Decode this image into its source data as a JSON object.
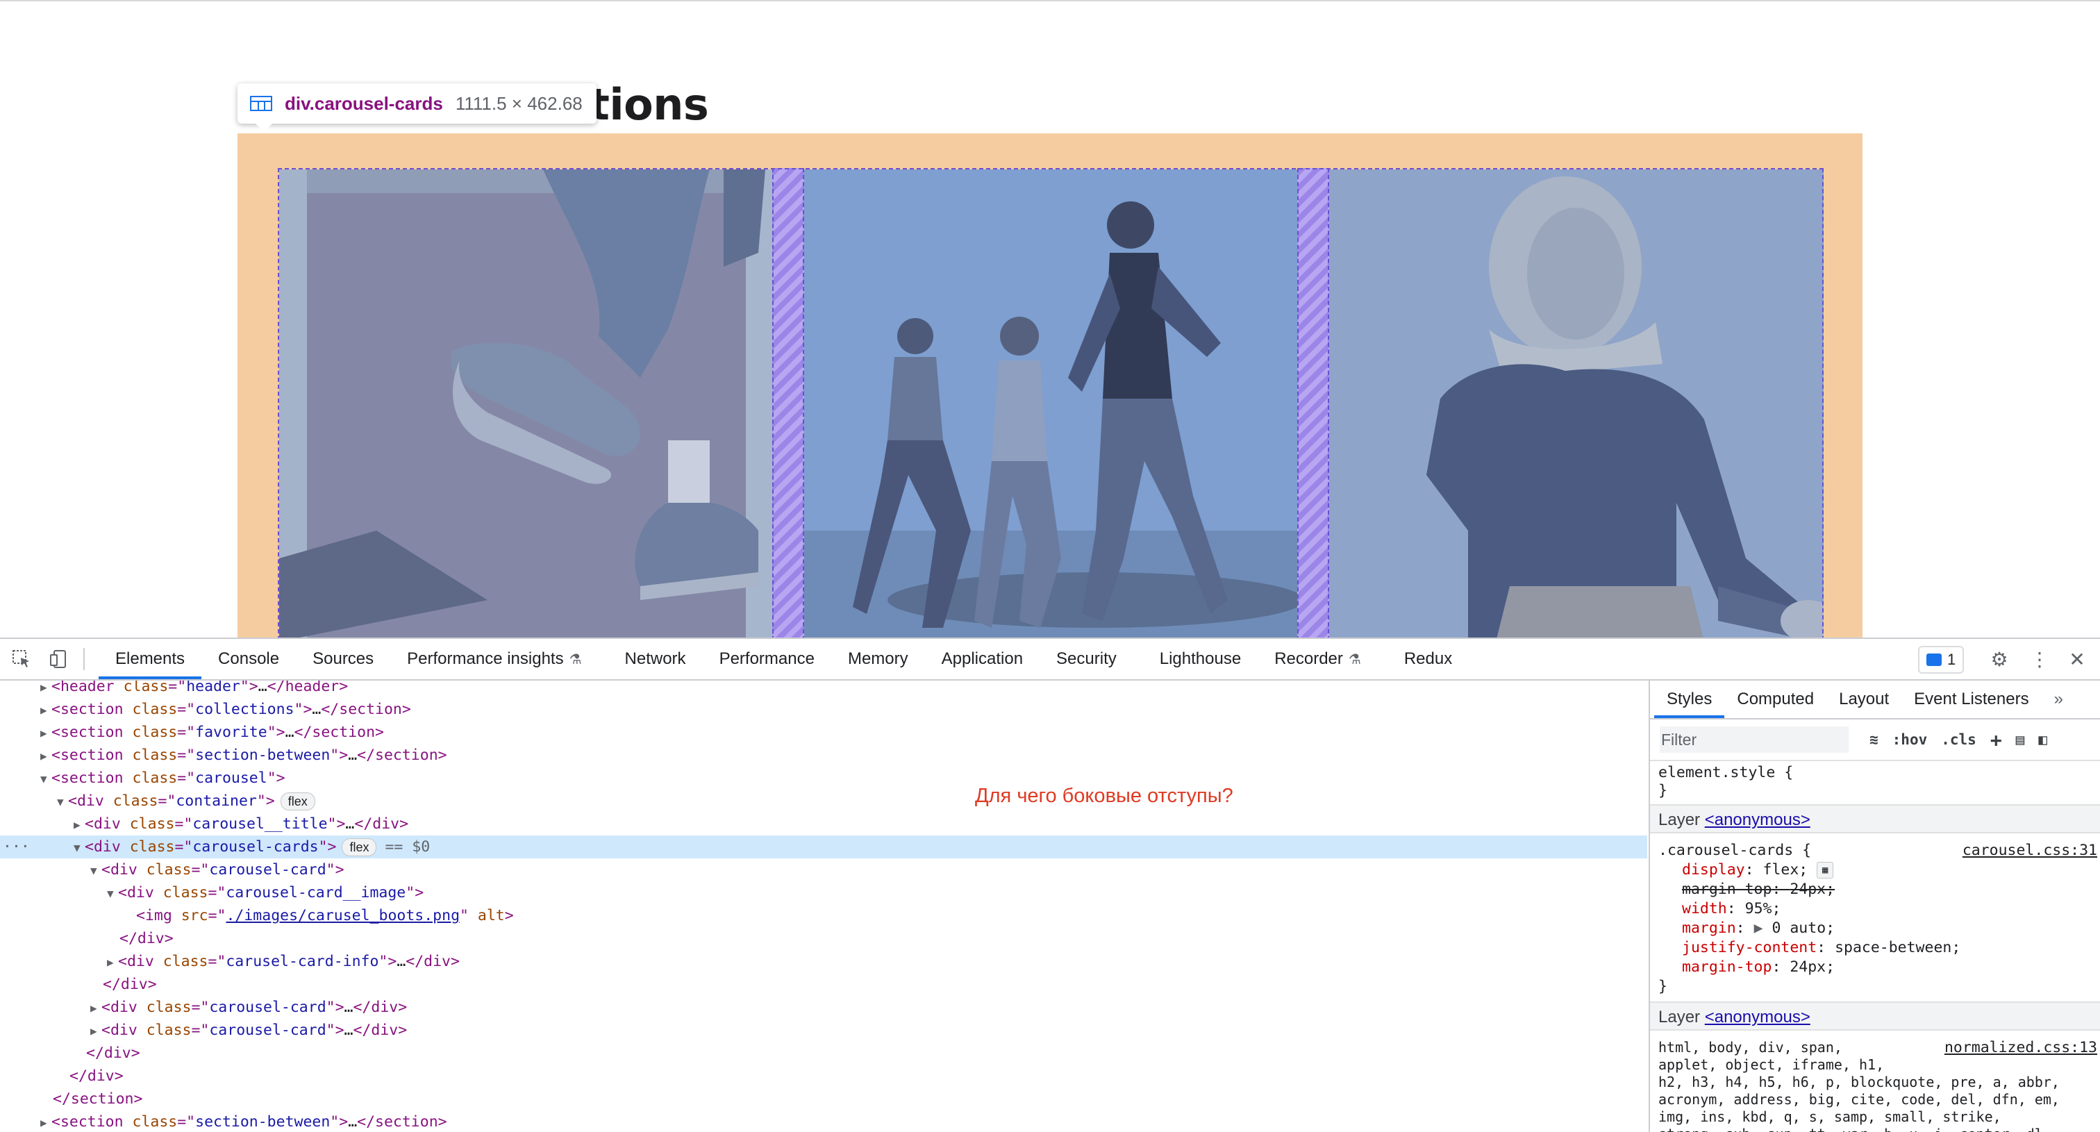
{
  "page": {
    "title": "ctions",
    "tooltip_name": "div.carousel-cards",
    "tooltip_size": "1111.5 × 462.68"
  },
  "devtools": {
    "tabs": [
      "Elements",
      "Console",
      "Sources",
      "Performance insights",
      "Network",
      "Performance",
      "Memory",
      "Application",
      "Security",
      "Lighthouse",
      "Recorder",
      "Redux"
    ],
    "issues_count": "1",
    "annotation": "Для чего боковые отступы?",
    "dom": {
      "l1": [
        "<header class=\"",
        "header",
        "\">…</header>"
      ],
      "l2_tag": "section",
      "l2_class": "collections",
      "l3_tag": "section",
      "l3_class": "favorite",
      "l4_tag": "section",
      "l4_class": "section-between",
      "l5_tag": "section",
      "l5_class": "carousel",
      "l6_tag": "div",
      "l6_class": "container",
      "l6_badge": "flex",
      "l7_tag": "div",
      "l7_class": "carousel__title",
      "l8_tag": "div",
      "l8_class": "carousel-cards",
      "l8_badge": "flex",
      "l8_sel": "== $0",
      "l9_tag": "div",
      "l9_class": "carousel-card",
      "l10_tag": "div",
      "l10_class": "carousel-card__image",
      "l11_tag": "img",
      "l11_src": "./images/carusel_boots.png",
      "l11_alt": "alt",
      "l12": "</div>",
      "l13_tag": "div",
      "l13_class": "carusel-card-info",
      "l14": "</div>",
      "l15_tag": "div",
      "l15_class": "carousel-card",
      "l16_tag": "div",
      "l16_class": "carousel-card",
      "l17": "</div>",
      "l18": "</div>",
      "l19": "</section>",
      "l20_tag": "section",
      "l20_class": "section-between"
    },
    "styles": {
      "tabs": [
        "Styles",
        "Computed",
        "Layout",
        "Event Listeners"
      ],
      "filter_placeholder": "Filter",
      "hov": ":hov",
      "cls": ".cls",
      "element_style": "element.style {",
      "close_brace": "}",
      "layer_label": "Layer",
      "layer_link": "<anonymous>",
      "rule_selector": ".carousel-cards {",
      "rule_source": "carousel.css:31",
      "decls": [
        {
          "prop": "display",
          "value": "flex;"
        },
        {
          "prop": "margin-top",
          "value": "24px;",
          "struck": true
        },
        {
          "prop": "width",
          "value": "95%;"
        },
        {
          "prop": "margin",
          "value": "0 auto;"
        },
        {
          "prop": "justify-content",
          "value": "space-between;"
        },
        {
          "prop": "margin-top",
          "value": "24px;"
        }
      ],
      "rule2_source": "normalized.css:13",
      "rule2_lines": [
        "html, body, div, span,",
        "applet, object, iframe, h1,",
        "h2, h3, h4, h5, h6, p, blockquote, pre, a, abbr,",
        "acronym, address, big, cite, code, del, dfn, em,",
        "img, ins, kbd, q, s, samp, small, strike,",
        "strong, sub, sup, tt, var, b, u, i, center, dl,"
      ]
    }
  },
  "colors": {
    "section_bg": "#f5cca0",
    "overlay": "#9fb8d9",
    "gap_fill": "#9b86e8",
    "tag": "#881280",
    "attr": "#994500",
    "value": "#1a1aa6",
    "annotation": "#e03a22",
    "accent": "#1a73e8"
  }
}
